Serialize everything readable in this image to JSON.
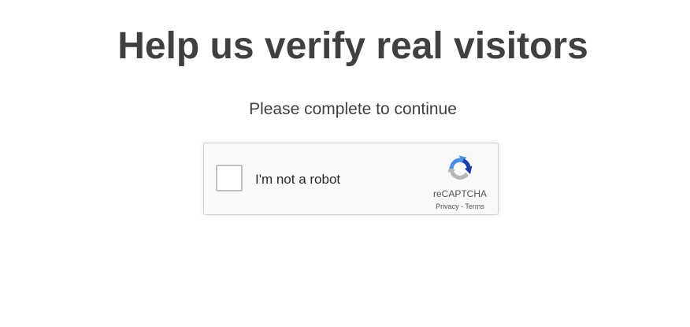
{
  "page": {
    "heading": "Help us verify real visitors",
    "subheading": "Please complete to continue"
  },
  "captcha": {
    "checkbox_label": "I'm not a robot",
    "checked": false,
    "brand": "reCAPTCHA",
    "privacy_link": "Privacy",
    "separator": " - ",
    "terms_link": "Terms",
    "logo_icon": "recaptcha-logo-icon",
    "colors": {
      "blue": "#4a90e2",
      "dark_blue": "#1c3aa9",
      "gray": "#b5b5b5"
    }
  }
}
